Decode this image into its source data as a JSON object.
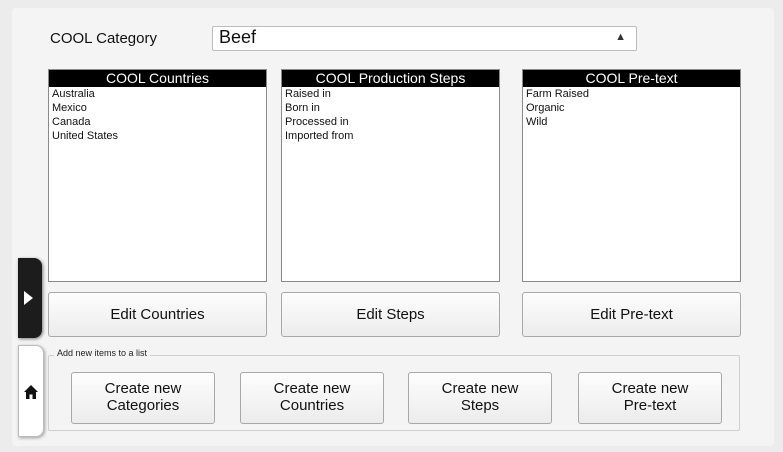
{
  "category": {
    "label": "COOL Category",
    "value": "Beef"
  },
  "lists": [
    {
      "header": "COOL Countries",
      "items": [
        "Australia",
        "Mexico",
        "Canada",
        "United States"
      ],
      "button": "Edit Countries"
    },
    {
      "header": "COOL Production Steps",
      "items": [
        "Raised in",
        "Born in",
        "Processed in",
        "Imported from"
      ],
      "button": "Edit Steps"
    },
    {
      "header": "COOL Pre-text",
      "items": [
        "Farm Raised",
        "Organic",
        "Wild"
      ],
      "button": "Edit Pre-text"
    }
  ],
  "add_section": {
    "legend": "Add new items to a list",
    "buttons": [
      {
        "line1": "Create new",
        "line2": "Categories"
      },
      {
        "line1": "Create new",
        "line2": "Countries"
      },
      {
        "line1": "Create new",
        "line2": "Steps"
      },
      {
        "line1": "Create new",
        "line2": "Pre-text"
      }
    ]
  },
  "icons": {
    "expand_tab": "play-icon",
    "home_tab": "home-icon"
  }
}
